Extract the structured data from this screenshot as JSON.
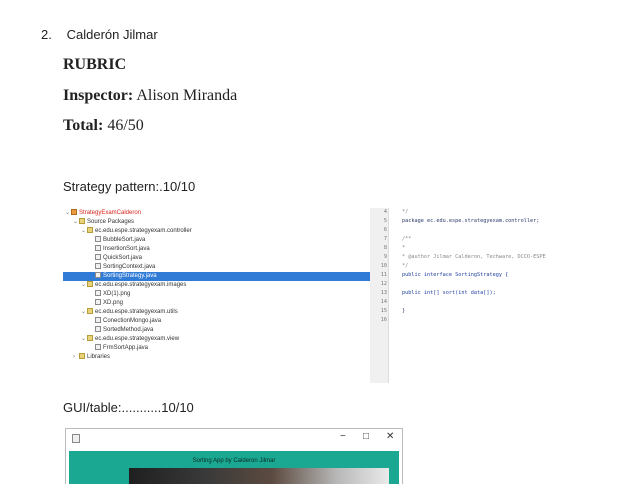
{
  "list": {
    "number": "2.",
    "name": "Calderón Jilmar"
  },
  "rubric": {
    "heading": "RUBRIC",
    "inspector_label": "Inspector:",
    "inspector_value": "Alison Miranda",
    "total_label": "Total:",
    "total_value": "46/50"
  },
  "strategy_section": "Strategy pattern:.10/10",
  "tree": {
    "project": "StrategyExamCalderon",
    "source_packages": "Source Packages",
    "pkg_controller": "ec.edu.espe.strategyexam.controller",
    "files_controller": [
      "BubbleSort.java",
      "InsertionSort.java",
      "QuickSort.java",
      "SortingContext.java",
      "SortingStrategy.java"
    ],
    "pkg_images": "ec.edu.espe.strategyexam.images",
    "files_images": [
      "XD(1).png",
      "XD.png"
    ],
    "pkg_utils": "ec.edu.espe.strategyexam.utils",
    "files_utils": [
      "ConectionMongo.java",
      "SortedMethod.java"
    ],
    "pkg_view": "ec.edu.espe.strategyexam.view",
    "files_view": [
      "FrmSortApp.java"
    ],
    "libraries": "Libraries"
  },
  "code": {
    "line_numbers": [
      "4",
      "5",
      "6",
      "7",
      "8",
      "9",
      "10",
      "11",
      "12",
      "13",
      "14",
      "15",
      "16"
    ],
    "lines": [
      "*/",
      "package ec.edu.espe.strategyexam.controller;",
      "",
      "/**",
      " *",
      " * @author Jilmar Calderon, Techware, DCCO-ESPE",
      " */",
      "public interface SortingStrategy {",
      "",
      "    public  int[] sort(int data[]);",
      "",
      "}",
      ""
    ]
  },
  "gui_section": "GUI/table:...........10/10",
  "window": {
    "minimize": "−",
    "maximize": "□",
    "close": "✕",
    "banner_title": "Sorting App by Calderon Jilmar"
  },
  "colors": {
    "selection": "#2f7bd6",
    "banner": "#1aa892",
    "project_name": "#d8261c"
  },
  "icons": [
    "project-icon",
    "folder-icon",
    "package-icon",
    "java-file-icon",
    "image-file-icon",
    "app-icon"
  ]
}
